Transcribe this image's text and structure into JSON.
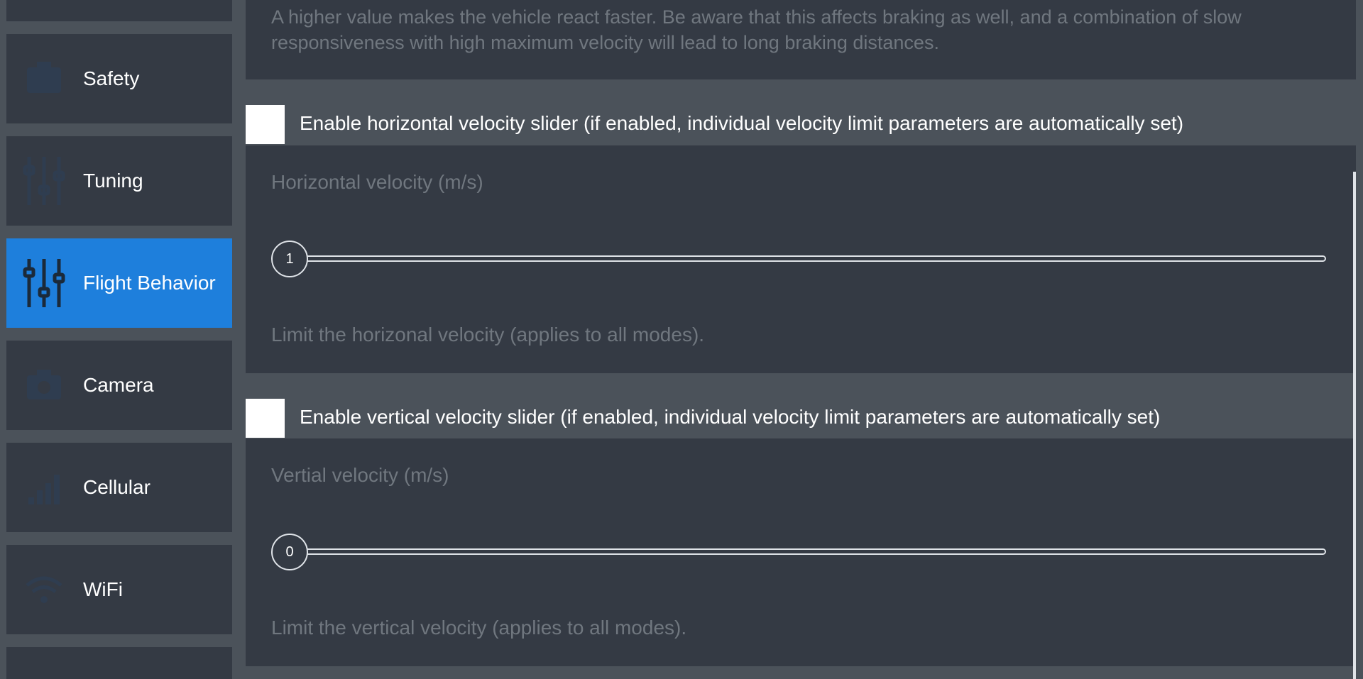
{
  "sidebar": {
    "items": [
      {
        "label": "",
        "icon": "partial-item"
      },
      {
        "label": "Safety",
        "icon": "safety-icon"
      },
      {
        "label": "Tuning",
        "icon": "sliders-icon"
      },
      {
        "label": "Flight Behavior",
        "icon": "sliders-icon",
        "active": true
      },
      {
        "label": "Camera",
        "icon": "camera-icon"
      },
      {
        "label": "Cellular",
        "icon": "signal-icon"
      },
      {
        "label": "WiFi",
        "icon": "wifi-icon"
      }
    ]
  },
  "main": {
    "top_description": {
      "line1": "A higher value makes the vehicle react faster. Be aware that this affects braking as well, and a combination of slow",
      "line2": "responsiveness with high maximum velocity will lead to long braking distances."
    },
    "horizontal": {
      "checkbox_label": "Enable horizontal velocity slider (if enabled, individual velocity limit parameters are automatically set)",
      "field_label": "Horizontal velocity (m/s)",
      "slider_value": "1",
      "description": "Limit the horizonal velocity (applies to all modes)."
    },
    "vertical": {
      "checkbox_label": "Enable vertical velocity slider (if enabled, individual velocity limit parameters are automatically set)",
      "field_label": "Vertial velocity (m/s)",
      "slider_value": "0",
      "description": "Limit the vertical velocity (applies to all modes)."
    }
  },
  "colors": {
    "background": "#4b525a",
    "panel": "#343a44",
    "accent": "#1e7fdc",
    "muted_text": "#70777f"
  }
}
